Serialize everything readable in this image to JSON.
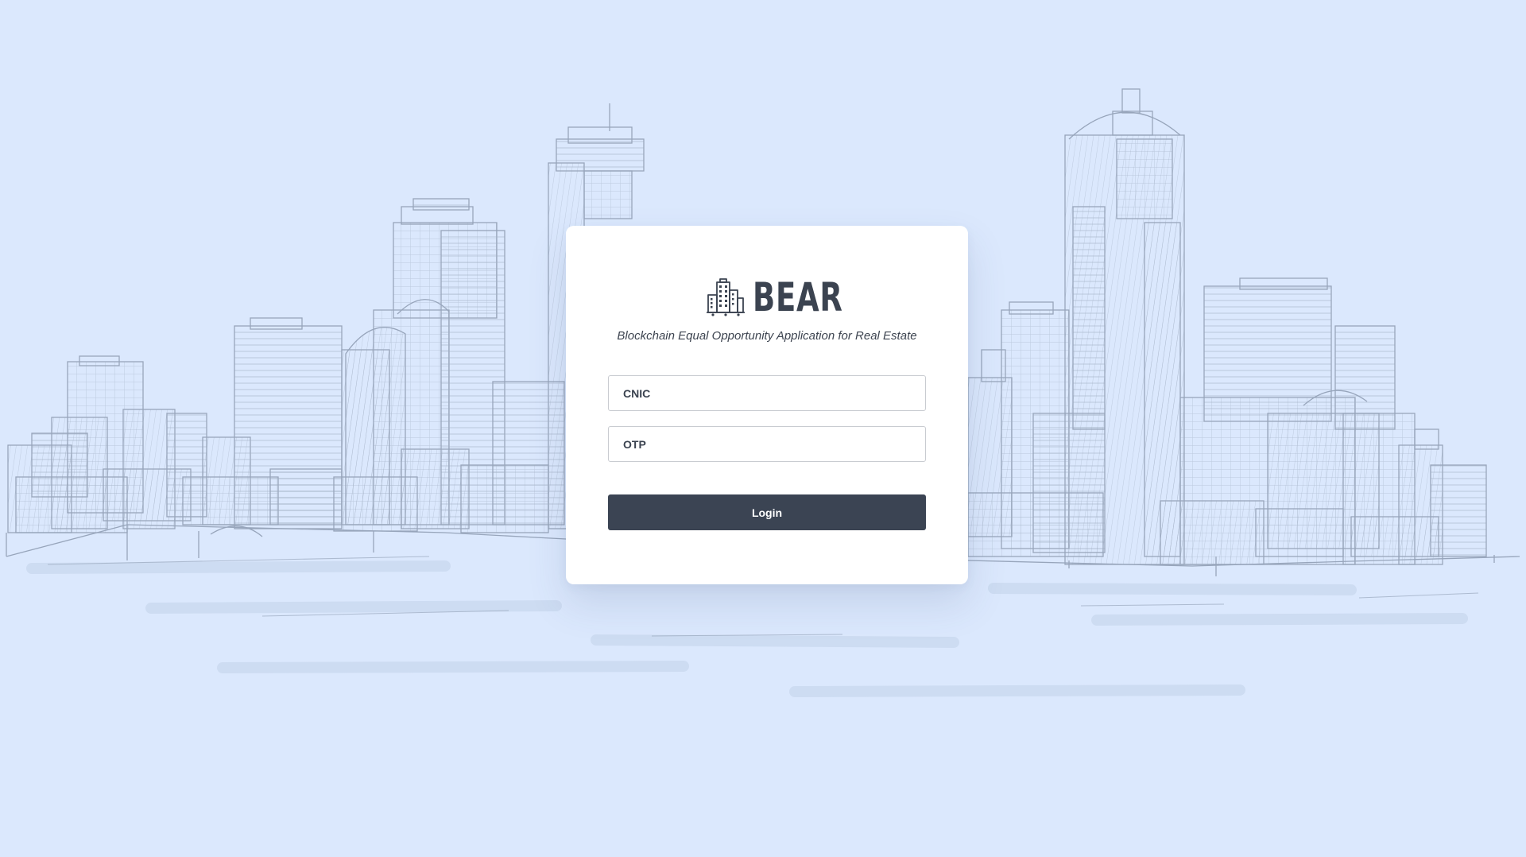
{
  "brand": {
    "name": "BEAR",
    "tagline": "Blockchain Equal Opportunity Application for Real Estate",
    "icon": "city-buildings-icon"
  },
  "form": {
    "cnic": {
      "placeholder": "CNIC",
      "value": ""
    },
    "otp": {
      "placeholder": "OTP",
      "value": ""
    },
    "login_label": "Login"
  },
  "colors": {
    "background": "#dbe8fd",
    "card": "#ffffff",
    "primary": "#3b4453",
    "text": "#3b4350",
    "sketch": "#8f9db2"
  },
  "background_art": "sketch-city-skyline"
}
